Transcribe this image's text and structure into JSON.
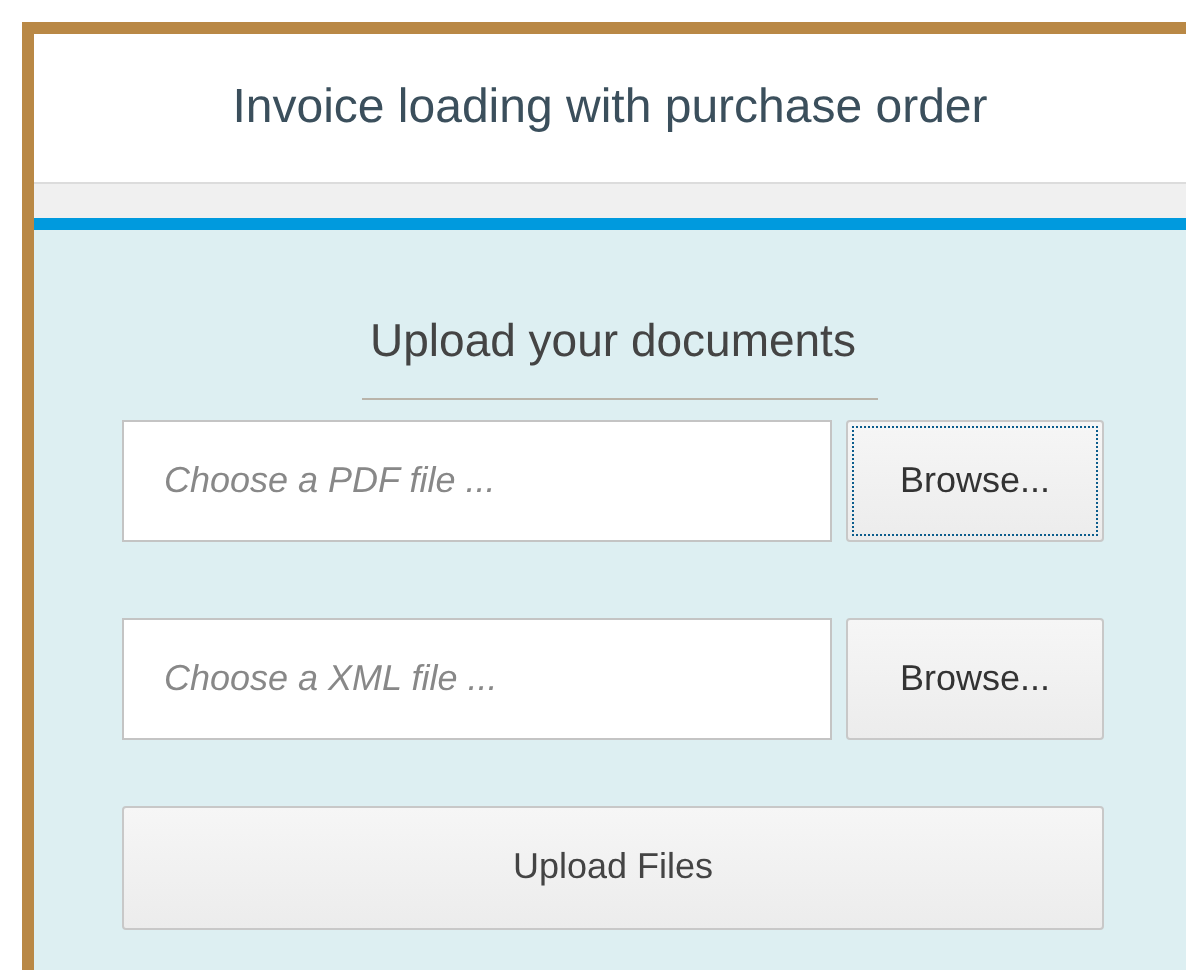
{
  "header": {
    "title": "Invoice loading with purchase order"
  },
  "form": {
    "heading": "Upload your documents",
    "files": [
      {
        "placeholder": "Choose a PDF file ...",
        "button": "Browse...",
        "focused": true
      },
      {
        "placeholder": "Choose a XML file ...",
        "button": "Browse...",
        "focused": false
      }
    ],
    "submit": "Upload Files"
  }
}
